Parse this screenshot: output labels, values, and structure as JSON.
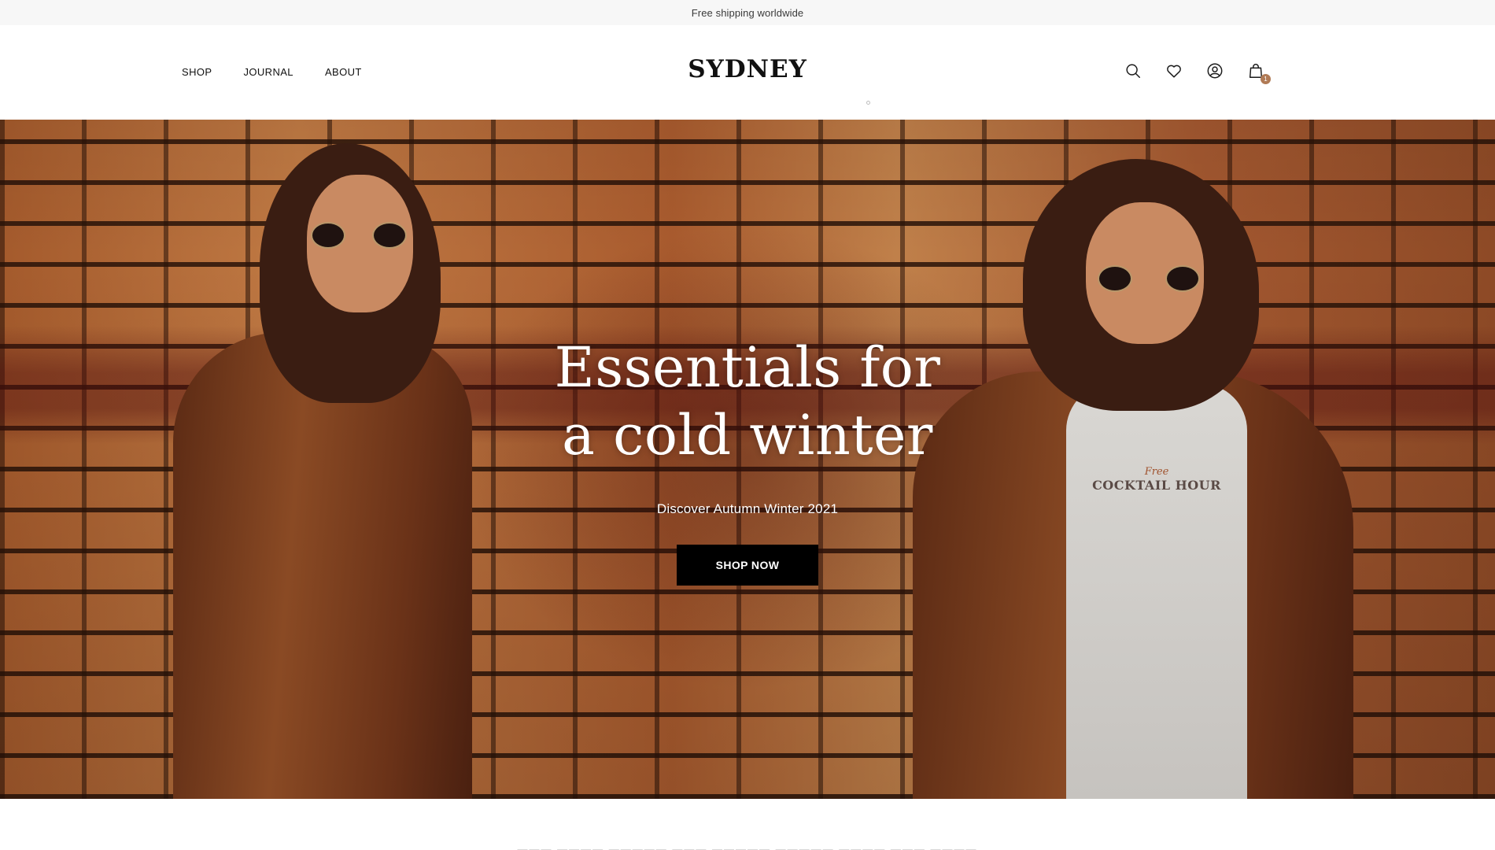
{
  "announcement": {
    "text": "Free shipping worldwide"
  },
  "header": {
    "logo": "SYDNEY",
    "nav": [
      {
        "label": "SHOP"
      },
      {
        "label": "JOURNAL"
      },
      {
        "label": "ABOUT"
      }
    ],
    "icons": [
      "search-icon",
      "wishlist-heart-icon",
      "account-icon",
      "cart-bag-icon"
    ],
    "cart_count": "1"
  },
  "hero": {
    "title_line1": "Essentials for",
    "title_line2": "a cold winter",
    "subtitle": "Discover Autumn Winter 2021",
    "cta_label": "SHOP NOW",
    "image_text": {
      "script": "Free",
      "main": "COCKTAIL HOUR"
    }
  },
  "colors": {
    "announcement_bg": "#f7f7f7",
    "cta_bg": "#000000",
    "cart_badge": "#b07a55",
    "hero_bg": "#a45a2c"
  }
}
